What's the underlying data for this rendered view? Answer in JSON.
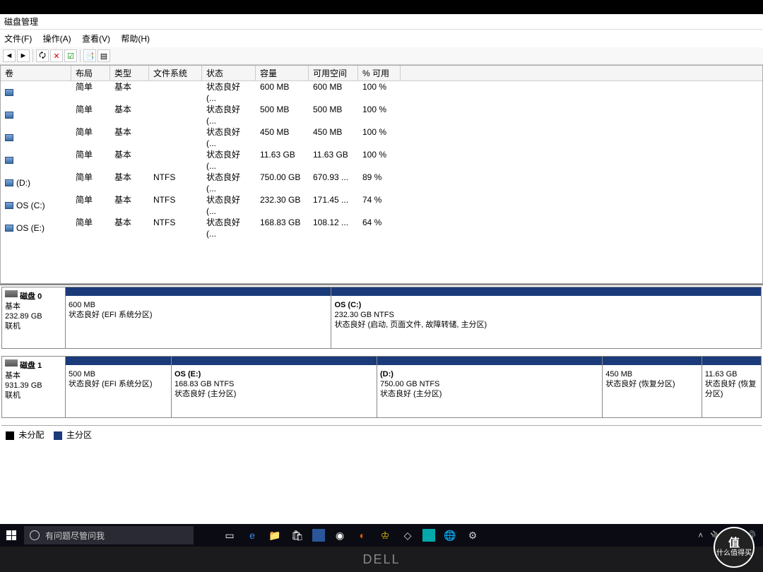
{
  "window": {
    "title": "磁盘管理",
    "menu": {
      "file": "文件(F)",
      "action": "操作(A)",
      "view": "查看(V)",
      "help": "帮助(H)"
    }
  },
  "columns": {
    "volume": "卷",
    "layout": "布局",
    "type": "类型",
    "fs": "文件系统",
    "status": "状态",
    "capacity": "容量",
    "free": "可用空间",
    "pct": "% 可用"
  },
  "volumes": [
    {
      "name": "",
      "layout": "简单",
      "type": "基本",
      "fs": "",
      "status": "状态良好 (...",
      "capacity": "600 MB",
      "free": "600 MB",
      "pct": "100 %"
    },
    {
      "name": "",
      "layout": "简单",
      "type": "基本",
      "fs": "",
      "status": "状态良好 (...",
      "capacity": "500 MB",
      "free": "500 MB",
      "pct": "100 %"
    },
    {
      "name": "",
      "layout": "简单",
      "type": "基本",
      "fs": "",
      "status": "状态良好 (...",
      "capacity": "450 MB",
      "free": "450 MB",
      "pct": "100 %"
    },
    {
      "name": "",
      "layout": "简单",
      "type": "基本",
      "fs": "",
      "status": "状态良好 (...",
      "capacity": "11.63 GB",
      "free": "11.63 GB",
      "pct": "100 %"
    },
    {
      "name": "(D:)",
      "layout": "简单",
      "type": "基本",
      "fs": "NTFS",
      "status": "状态良好 (...",
      "capacity": "750.00 GB",
      "free": "670.93 ...",
      "pct": "89 %"
    },
    {
      "name": "OS (C:)",
      "layout": "简单",
      "type": "基本",
      "fs": "NTFS",
      "status": "状态良好 (...",
      "capacity": "232.30 GB",
      "free": "171.45 ...",
      "pct": "74 %"
    },
    {
      "name": "OS (E:)",
      "layout": "简单",
      "type": "基本",
      "fs": "NTFS",
      "status": "状态良好 (...",
      "capacity": "168.83 GB",
      "free": "108.12 ...",
      "pct": "64 %"
    }
  ],
  "disks": [
    {
      "label": {
        "name": "磁盘 0",
        "type": "基本",
        "size": "232.89 GB",
        "status": "联机"
      },
      "partitions": [
        {
          "title": "",
          "line2": "600 MB",
          "line3": "状态良好 (EFI 系统分区)",
          "flex": 38
        },
        {
          "title": "OS  (C:)",
          "line2": "232.30 GB NTFS",
          "line3": "状态良好 (启动, 页面文件, 故障转储, 主分区)",
          "flex": 62
        }
      ]
    },
    {
      "label": {
        "name": "磁盘 1",
        "type": "基本",
        "size": "931.39 GB",
        "status": "联机"
      },
      "partitions": [
        {
          "title": "",
          "line2": "500 MB",
          "line3": "状态良好 (EFI 系统分区)",
          "flex": 15
        },
        {
          "title": "OS  (E:)",
          "line2": "168.83 GB NTFS",
          "line3": "状态良好 (主分区)",
          "flex": 30
        },
        {
          "title": "(D:)",
          "line2": "750.00 GB NTFS",
          "line3": "状态良好 (主分区)",
          "flex": 33
        },
        {
          "title": "",
          "line2": "450 MB",
          "line3": "状态良好 (恢复分区)",
          "flex": 14
        },
        {
          "title": "",
          "line2": "11.63 GB",
          "line3": "状态良好 (恢复分区)",
          "flex": 8
        }
      ]
    }
  ],
  "legend": {
    "unalloc": "未分配",
    "primary": "主分区"
  },
  "taskbar": {
    "search": "有问题尽管问我",
    "tray_up": "˄"
  },
  "bezel": "DELL",
  "watermark": {
    "v": "值",
    "text": "什么值得买"
  }
}
